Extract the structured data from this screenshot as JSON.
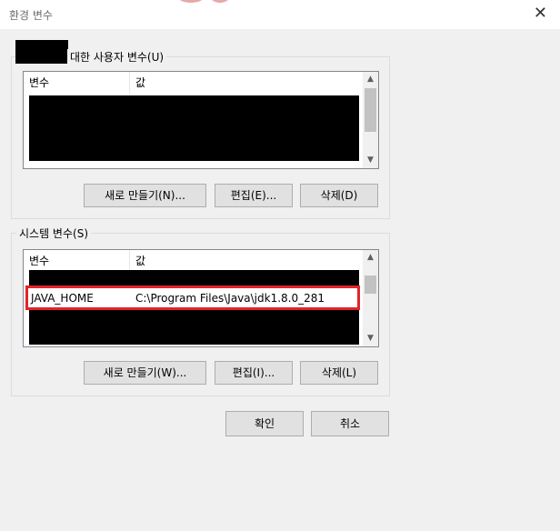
{
  "window": {
    "title": "환경 변수",
    "close_glyph": "✕"
  },
  "user_vars": {
    "group_label": "대한 사용자 변수(U)",
    "col_name": "변수",
    "col_value": "값",
    "buttons": {
      "new": "새로 만들기(N)...",
      "edit": "편집(E)...",
      "delete": "삭제(D)"
    }
  },
  "system_vars": {
    "group_label": "시스템 변수(S)",
    "col_name": "변수",
    "col_value": "값",
    "rows": [
      {
        "name": "JAVA_HOME",
        "value": "C:\\Program Files\\Java\\jdk1.8.0_281"
      }
    ],
    "buttons": {
      "new": "새로 만들기(W)...",
      "edit": "편집(I)...",
      "delete": "삭제(L)"
    }
  },
  "dialog_buttons": {
    "ok": "확인",
    "cancel": "취소"
  },
  "icons": {
    "scroll_up": "up-arrow-icon",
    "scroll_down": "down-arrow-icon"
  },
  "colors": {
    "highlight": "#e2232b",
    "background": "#f0f0f0"
  }
}
